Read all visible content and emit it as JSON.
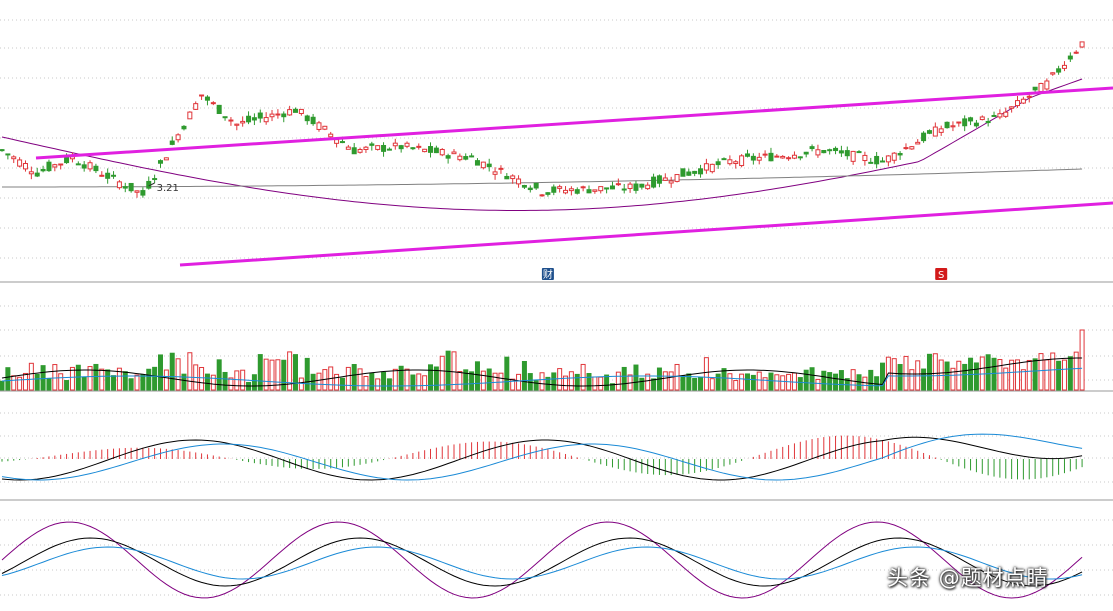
{
  "chart_data": [
    {
      "type": "candlestick",
      "panel": "price",
      "low_marker_label": "3.21",
      "event_markers": [
        {
          "label": "财",
          "candle_index": 93,
          "color": "#1e4f8c"
        },
        {
          "label": "S",
          "candle_index": 160,
          "color": "#d21a1a"
        }
      ],
      "ohlc_series_note": "",
      "moving_averages": [
        {
          "color": "#800080",
          "shape": "declining then rising"
        },
        {
          "color": "#808080",
          "shape": "flat then slightly rising"
        }
      ],
      "trend_channel_color": "#e020e0",
      "colors": {
        "up": "#e0363a",
        "down": "#2f9a2f"
      }
    },
    {
      "type": "bar",
      "panel": "volume",
      "colors": {
        "up": "#e0363a",
        "down": "#2f9a2f",
        "ma_short": "#000000",
        "ma_long": "#1a8ad6"
      }
    },
    {
      "type": "macd",
      "panel": "macd",
      "colors": {
        "dif": "#000000",
        "dea": "#1a8ad6",
        "hist_up": "#e0363a",
        "hist_down": "#2f9a2f"
      }
    },
    {
      "type": "kdj",
      "panel": "kdj",
      "colors": {
        "k": "#000000",
        "d": "#1a8ad6",
        "j": "#800080"
      }
    }
  ],
  "watermark": "头条 @题材点睛"
}
